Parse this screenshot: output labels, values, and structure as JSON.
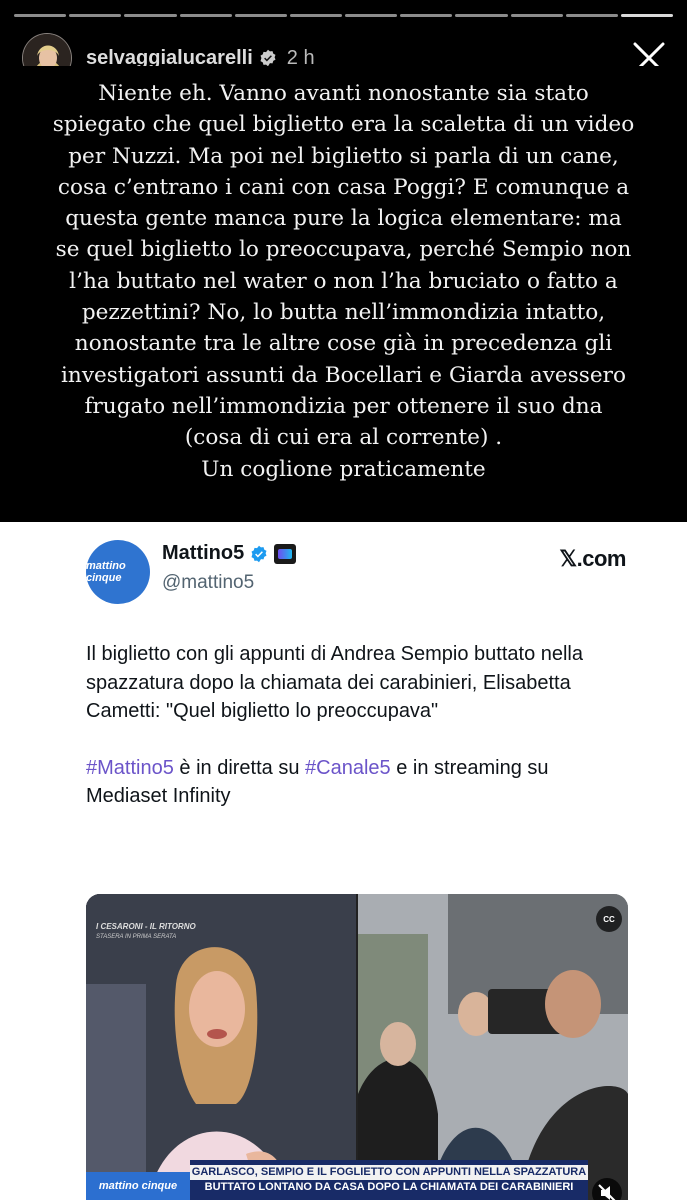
{
  "story": {
    "segments": 12,
    "active_segment": 12,
    "username": "selvaggialucarelli",
    "time_ago": "2 h"
  },
  "overlay": {
    "lines": [
      "Niente eh. Vanno avanti nonostante sia stato",
      "spiegato che quel biglietto era la scaletta di un video",
      "per Nuzzi. Ma poi nel biglietto si parla di un cane,",
      "cosa c’entrano i cani con casa Poggi? E comunque a",
      "questa gente manca pure la logica elementare: ma",
      "se quel biglietto lo preoccupava, perché Sempio non",
      "l’ha buttato nel water o non l’ha bruciato o fatto a",
      "pezzettini? No, lo butta nell’immondizia intatto,",
      "nonostante tra le altre cose già in precedenza gli",
      "investigatori assunti da Bocellari e Giarda avessero",
      "frugato nell’immondizia per ottenere il suo dna",
      "(cosa di cui era al corrente) .",
      "Un coglione praticamente"
    ]
  },
  "tweet": {
    "avatar_text": "mattino cinque",
    "name": "Mattino5",
    "handle": "@mattino5",
    "source": "𝕏.com",
    "paragraph1": "Il biglietto con gli appunti di Andrea Sempio buttato nella spazzatura dopo la chiamata dei carabinieri, Elisabetta Cametti: \"Quel biglietto lo preoccupava\"",
    "p2_tag1": "#Mattino5",
    "p2_text1": " è in diretta su ",
    "p2_tag2": "#Canale5",
    "p2_text2": " e in streaming su Mediaset Infinity",
    "tag_color": "#6b54c9"
  },
  "media": {
    "left_caption": "I CESARONI - IL RITORNO",
    "left_subcaption": "STASERA IN PRIMA SERATA",
    "cc_label": "CC",
    "logo": "mattino cinque",
    "ticker_line1": "GARLASCO, SEMPIO E IL FOGLIETTO CON APPUNTI NELLA SPAZZATURA",
    "ticker_line2": "BUTTATO LONTANO DA CASA DOPO LA CHIAMATA DEI CARABINIERI"
  }
}
